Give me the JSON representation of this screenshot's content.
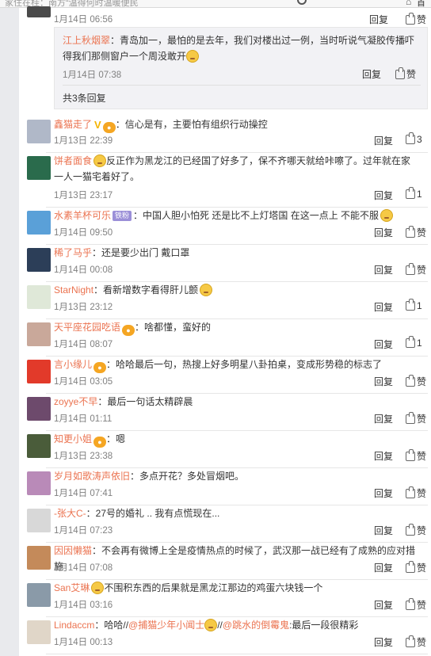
{
  "topbar": {
    "search_text": "家住在桂：南方“温得何时温暖便民",
    "home_label": "首"
  },
  "top_comment": {
    "time": "1月14日 06:56",
    "reply": "回复",
    "like": "赞"
  },
  "nested": {
    "name": "江上秋烟翠",
    "text_before": "：青岛加一，最怕的是去年，我们对楼出过一例，当时听说气凝胶传播吓得我们那侧窗户一个周没敢开",
    "time": "1月14日 07:38",
    "reply": "回复",
    "like": "赞",
    "total": "共3条回复"
  },
  "comments": [
    {
      "name": "鑫猫走了",
      "text": "：信心是有，主要怕有组织行动操控",
      "time": "1月13日 22:39",
      "reply": "回复",
      "like": "3",
      "avatar": "#b0b8c8"
    },
    {
      "name": "饼者面食",
      "text": "反正作为黑龙江的已经国了好多了，保不齐哪天就给咔嚓了。过年就在家一人一猫宅着好了。",
      "time": "1月13日 23:17",
      "reply": "回复",
      "like": "1",
      "avatar": "#2a6b4c"
    },
    {
      "name": "水素羊杯可乐",
      "text": "：中国人胆小怕死 还是比不上灯塔国 在这一点上 不能不服",
      "time": "1月14日 09:50",
      "reply": "回复",
      "like": "赞",
      "avatar": "#5aa0d8",
      "lv": "铁粉"
    },
    {
      "name": "稀了马乎",
      "text": "：还是要少出门 戴口罩",
      "time": "1月14日 00:08",
      "reply": "回复",
      "like": "赞",
      "avatar": "#2c3e58"
    },
    {
      "name": "StarNight",
      "text": "：看新增数字看得肝儿颤",
      "time": "1月13日 23:12",
      "reply": "回复",
      "like": "1",
      "avatar": "#dfe8d8"
    },
    {
      "name": "天平座花园吃语",
      "text": "：啥都懂，蛮好的",
      "time": "1月14日 08:07",
      "reply": "回复",
      "like": "1",
      "avatar": "#c9a89a"
    },
    {
      "name": "言小缘儿",
      "text": "：哈哈最后一句，热搜上好多明星八卦拍桌，变成形势稳的标志了",
      "time": "1月14日 03:05",
      "reply": "回复",
      "like": "赞",
      "avatar": "#e23a2a"
    },
    {
      "name": "zoyye不早",
      "text": "：最后一句话太精辟晨",
      "time": "1月14日 01:11",
      "reply": "回复",
      "like": "赞",
      "avatar": "#6d4a6c"
    },
    {
      "name": "知更小姐",
      "text": "：嗯",
      "time": "1月13日 23:38",
      "reply": "回复",
      "like": "赞",
      "avatar": "#4a5c3a"
    },
    {
      "name": "岁月如歌涛声依旧",
      "text": "：多点开花？多处冒烟吧。",
      "time": "1月14日 07:41",
      "reply": "回复",
      "like": "赞",
      "avatar": "#b98ab8"
    },
    {
      "name": "-张大C-",
      "text": "：27号的婚礼 .. 我有点慌现在...",
      "time": "1月14日 07:23",
      "reply": "回复",
      "like": "赞",
      "avatar": "#d8d8d8"
    },
    {
      "name": "因因懒猫",
      "text": "：不会再有微博上全是疫情热点的时候了，武汉那一战已经有了成熟的应对措施",
      "time": "1月14日 07:08",
      "reply": "回复",
      "like": "赞",
      "avatar": "#c48a5a"
    },
    {
      "name": "San艾琳",
      "text": "不围积东西的后果就是黑龙江那边的鸡蛋六块钱一个",
      "time": "1月14日 03:16",
      "reply": "回复",
      "like": "赞",
      "avatar": "#8a9aa8"
    },
    {
      "name": "Lindaccm",
      "text_a": "：哈哈//",
      "mention1": "@捕猫少年小闻士",
      "text_b": "//",
      "mention2": "@跳水的倒霉鬼",
      "text_c": ":最后一段很精彩",
      "time": "1月14日 00:13",
      "reply": "回复",
      "like": "赞",
      "avatar": "#e0d6c8"
    }
  ]
}
